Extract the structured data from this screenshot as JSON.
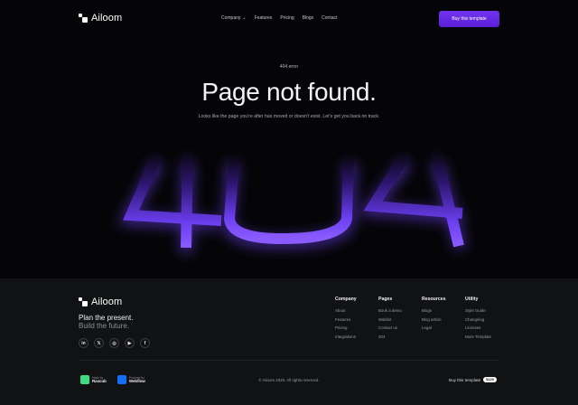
{
  "nav": {
    "brand": "Ailoom",
    "menu": [
      "Company",
      "Features",
      "Pricing",
      "Blogs",
      "Contact"
    ],
    "buy_label": "Buy this template"
  },
  "hero": {
    "eyebrow": "404 error",
    "title": "Page not found.",
    "subtitle": "Looks like the page you're after has moved or doesn't exist. Let's get you back on track.",
    "big_text": "404",
    "accent_color": "#6a3cf0"
  },
  "footer": {
    "brand": "Ailoom",
    "tagline_line1": "Plan the present.",
    "tagline_line2": "Build the future.",
    "socials": [
      "linkedin-icon",
      "x-icon",
      "instagram-icon",
      "youtube-icon",
      "facebook-icon"
    ],
    "columns": [
      {
        "title": "Company",
        "links": [
          "About",
          "Features",
          "Pricing",
          "Integrations"
        ]
      },
      {
        "title": "Pages",
        "links": [
          "Book a demo",
          "Waitlist",
          "Contact us",
          "404"
        ]
      },
      {
        "title": "Resources",
        "links": [
          "Blogs",
          "Blog article",
          "Legal"
        ]
      },
      {
        "title": "Utility",
        "links": [
          "Style Guide",
          "Changelog",
          "Licenses",
          "More Template"
        ]
      }
    ],
    "badge1": {
      "small": "Made by",
      "name": "Ravcub"
    },
    "badge2": {
      "small": "Powered by",
      "name": "Webflow"
    },
    "copyright": "© Ailoom 2025. All rights reserved.",
    "buy_label": "Buy this template",
    "price": "$129"
  }
}
